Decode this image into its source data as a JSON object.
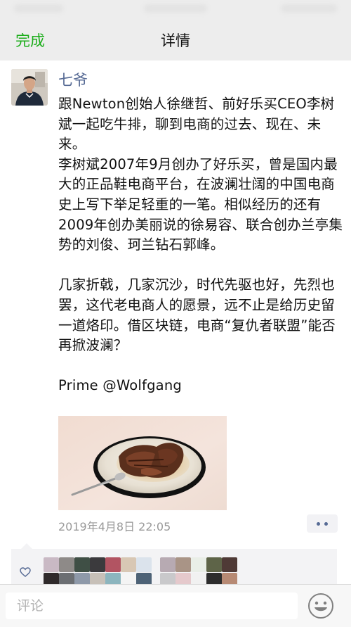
{
  "nav": {
    "done_label": "完成",
    "title": "详情"
  },
  "post": {
    "author": "七爷",
    "text": "跟Newton创始人徐继哲、前好乐买CEO李树斌一起吃牛排，聊到电商的过去、现在、未来。\n李树斌2007年9月创办了好乐买，曾是国内最大的正品鞋电商平台，在波澜壮阔的中国电商史上写下举足轻重的一笔。相似经历的还有2009年创办美丽说的徐易容、联合创办兰亭集势的刘俊、珂兰钻石郭峰。\n\n几家折戟，几家沉沙，时代先驱也好，先烈也罢，这代老电商人的愿景，远不止是给历史留一道烙印。借区块链，电商“复仇者联盟”能否再掀波澜？\n\nPrime @Wolfgang",
    "photo": "steak-plate-photo",
    "timestamp": "2019年4月8日 22:05"
  },
  "likes": {
    "icon": "heart-outline-icon",
    "avatar_colors": [
      "#c9b9c4",
      "#8e8a88",
      "#3f4f45",
      "#3b3a3d",
      "#b25462",
      "#d8c7b4",
      "#dbe3ec",
      "#b7aab2",
      "#a99486",
      "#e9eee7",
      "#5e6448",
      "#4f3a36",
      "#2f2a2b",
      "#6b6e72",
      "#8e99a9",
      "#c7c0b8",
      "#8cb5be",
      "#f4f4f4",
      "#4d6276",
      "#c9c9cb",
      "#e5c9cc",
      "#f1f1f1",
      "#2d2d2d",
      "#b78a74"
    ]
  },
  "comment": {
    "placeholder": "评论",
    "emoji_icon": "emoji-smile-icon"
  }
}
